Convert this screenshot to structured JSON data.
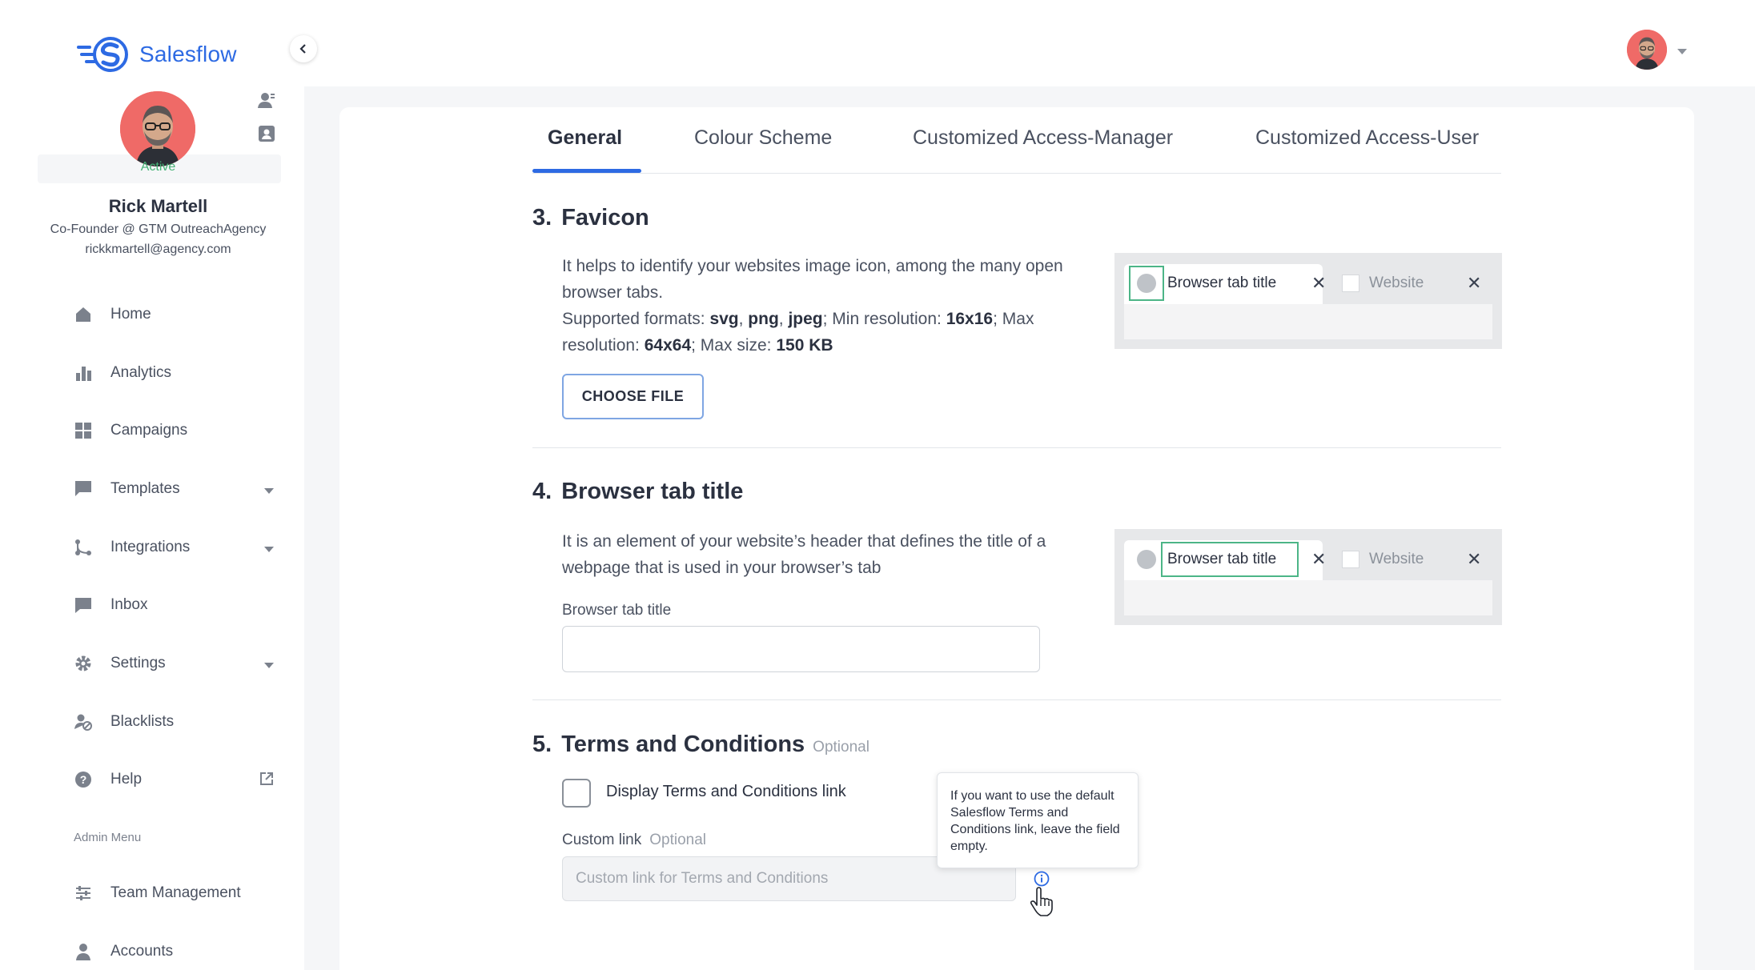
{
  "brand": {
    "name": "Salesflow",
    "accent": "#2d6ae3"
  },
  "profile": {
    "status": "Active",
    "name": "Rick Martell",
    "role": "Co-Founder @ GTM OutreachAgency",
    "email": "rickkmartell@agency.com"
  },
  "nav": {
    "items": [
      {
        "label": "Home",
        "icon": "home-icon"
      },
      {
        "label": "Analytics",
        "icon": "bar-chart-icon"
      },
      {
        "label": "Campaigns",
        "icon": "grid-icon"
      },
      {
        "label": "Templates",
        "icon": "chat-icon",
        "has_submenu": true
      },
      {
        "label": "Integrations",
        "icon": "branch-icon",
        "has_submenu": true
      },
      {
        "label": "Inbox",
        "icon": "inbox-icon"
      },
      {
        "label": "Settings",
        "icon": "gear-icon",
        "has_submenu": true
      },
      {
        "label": "Blacklists",
        "icon": "user-block-icon"
      },
      {
        "label": "Help",
        "icon": "help-icon",
        "external": true
      }
    ],
    "admin_label": "Admin Menu",
    "admin_items": [
      {
        "label": "Team Management",
        "icon": "sliders-icon"
      },
      {
        "label": "Accounts",
        "icon": "person-icon"
      }
    ]
  },
  "tabs": [
    {
      "label": "General",
      "active": true
    },
    {
      "label": "Colour Scheme",
      "active": false
    },
    {
      "label": "Customized Access-Manager",
      "active": false
    },
    {
      "label": "Customized Access-User",
      "active": false
    }
  ],
  "favicon": {
    "number": "3.",
    "title": "Favicon",
    "desc": "It helps to identify your websites image icon, among the many open browser tabs.",
    "formats_prefix": "Supported formats: ",
    "format1": "svg",
    "format2": "png",
    "format3": "jpeg",
    "min_label": "; Min resolution: ",
    "min_res": "16x16",
    "max_label": "; Max resolution: ",
    "max_res": "64x64",
    "size_label": "; Max size: ",
    "max_size": "150 KB",
    "button": "CHOOSE FILE"
  },
  "tab_title": {
    "number": "4.",
    "title": "Browser tab title",
    "desc": "It is an element of your website’s header that defines the title of a webpage that is used in your browser’s tab",
    "field_label": "Browser tab title",
    "value": ""
  },
  "preview": {
    "tab_title": "Browser tab title",
    "website": "Website",
    "close": "✕"
  },
  "terms": {
    "number": "5.",
    "title": "Terms and Conditions",
    "optional": "Optional",
    "checkbox_label": "Display Terms and Conditions link",
    "checked": false,
    "link_label": "Custom link",
    "link_optional": "Optional",
    "link_placeholder": "Custom link for Terms and Conditions",
    "tooltip": "If you want to use the default Salesflow Terms and Conditions link, leave the field empty."
  }
}
